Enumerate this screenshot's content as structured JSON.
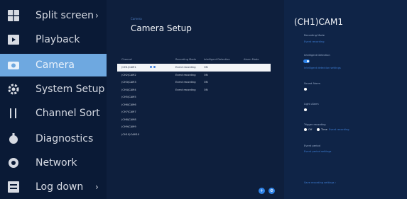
{
  "menu": {
    "items": [
      {
        "label": "Split screen",
        "icon": "grid-icon",
        "arrow": "›"
      },
      {
        "label": "Playback",
        "icon": "playback-icon",
        "arrow": ""
      },
      {
        "label": "Camera",
        "icon": "camera-icon",
        "arrow": "",
        "active": true
      },
      {
        "label": "System Setup",
        "icon": "settings-icon",
        "arrow": ""
      },
      {
        "label": "Channel Sort",
        "icon": "sort-icon",
        "arrow": ""
      },
      {
        "label": "Diagnostics",
        "icon": "diagnostics-icon",
        "arrow": ""
      },
      {
        "label": "Network",
        "icon": "network-icon",
        "arrow": ""
      },
      {
        "label": "Log down",
        "icon": "logout-icon",
        "arrow": "›"
      }
    ]
  },
  "center": {
    "breadcrumb": "Camera",
    "title": "Camera Setup",
    "table": {
      "headers": [
        "Channel",
        "Recording Mode",
        "Intelligent Detection",
        "Alarm Mode"
      ],
      "rows": [
        {
          "channel": "(CH1)CAM1",
          "mode": "Event recording",
          "detect": "ON",
          "selected": true
        },
        {
          "channel": "(CH2)CAM2",
          "mode": "Event recording",
          "detect": "ON"
        },
        {
          "channel": "(CH3)CAM3",
          "mode": "Event recording",
          "detect": "ON"
        },
        {
          "channel": "(CH4)CAM4",
          "mode": "Event recording",
          "detect": "ON"
        },
        {
          "channel": "(CH5)CAM5",
          "mode": "",
          "detect": ""
        },
        {
          "channel": "(CH6)CAM6",
          "mode": "",
          "detect": ""
        },
        {
          "channel": "(CH7)CAM7",
          "mode": "",
          "detect": ""
        },
        {
          "channel": "(CH8)CAM8",
          "mode": "",
          "detect": ""
        },
        {
          "channel": "(CH9)CAM9",
          "mode": "",
          "detect": ""
        },
        {
          "channel": "(CH10)CAM10",
          "mode": "",
          "detect": ""
        }
      ]
    },
    "buttons": [
      "+",
      "⚙"
    ]
  },
  "right": {
    "cam_title": "(CH1)CAM1",
    "recording_mode_label": "Recording Mode",
    "recording_mode_value": "Event recording",
    "intelligent_label": "Intelligent Detection",
    "intelligent_sub": "Intelligent detection settings",
    "sound_label": "Sound Alarm",
    "light_label": "Light Alarm",
    "trigger_label": "Trigger recording",
    "trigger_opt1": "Off",
    "trigger_opt2": "Time",
    "trigger_opt3": "Event recording",
    "event_label": "Event period",
    "event_value": "Event period settings",
    "footer": "Save recording settings  ›"
  }
}
